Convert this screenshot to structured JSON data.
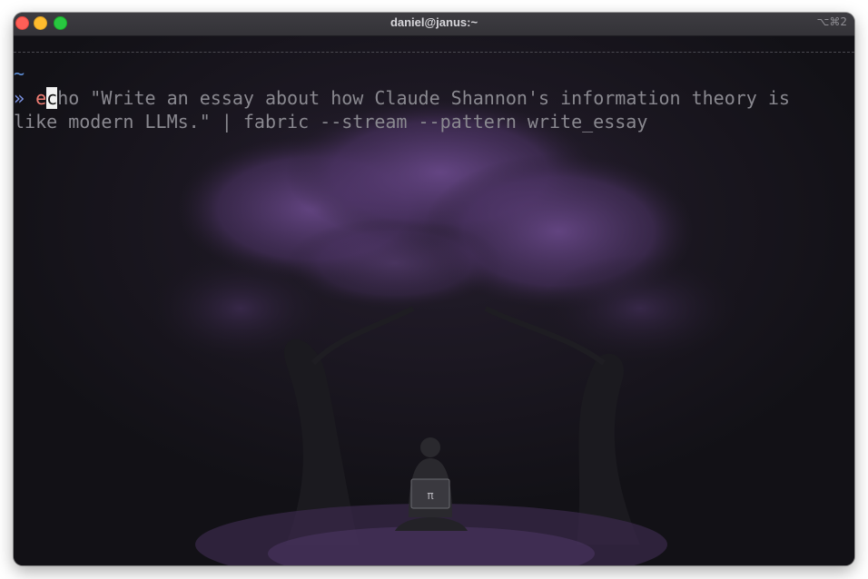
{
  "window": {
    "title": "daniel@janus:~",
    "shortcut": "⌥⌘2"
  },
  "terminal": {
    "cwd_marker": "~",
    "prompt_symbol": "»",
    "command_first_char": "e",
    "cursor_char": "c",
    "command_rest_line1": "ho \"Write an essay about how Claude Shannon's information theory is",
    "command_line2": "like modern LLMs.\" | fabric --stream --pattern write_essay"
  },
  "colors": {
    "background": "#121116",
    "prompt": "#7e95e6",
    "tilde": "#5d8fd8",
    "command_highlight": "#ef7d73",
    "text": "#8a8990",
    "foliage": "#6a4a8c"
  },
  "background_image": {
    "laptop_logo": "π"
  }
}
